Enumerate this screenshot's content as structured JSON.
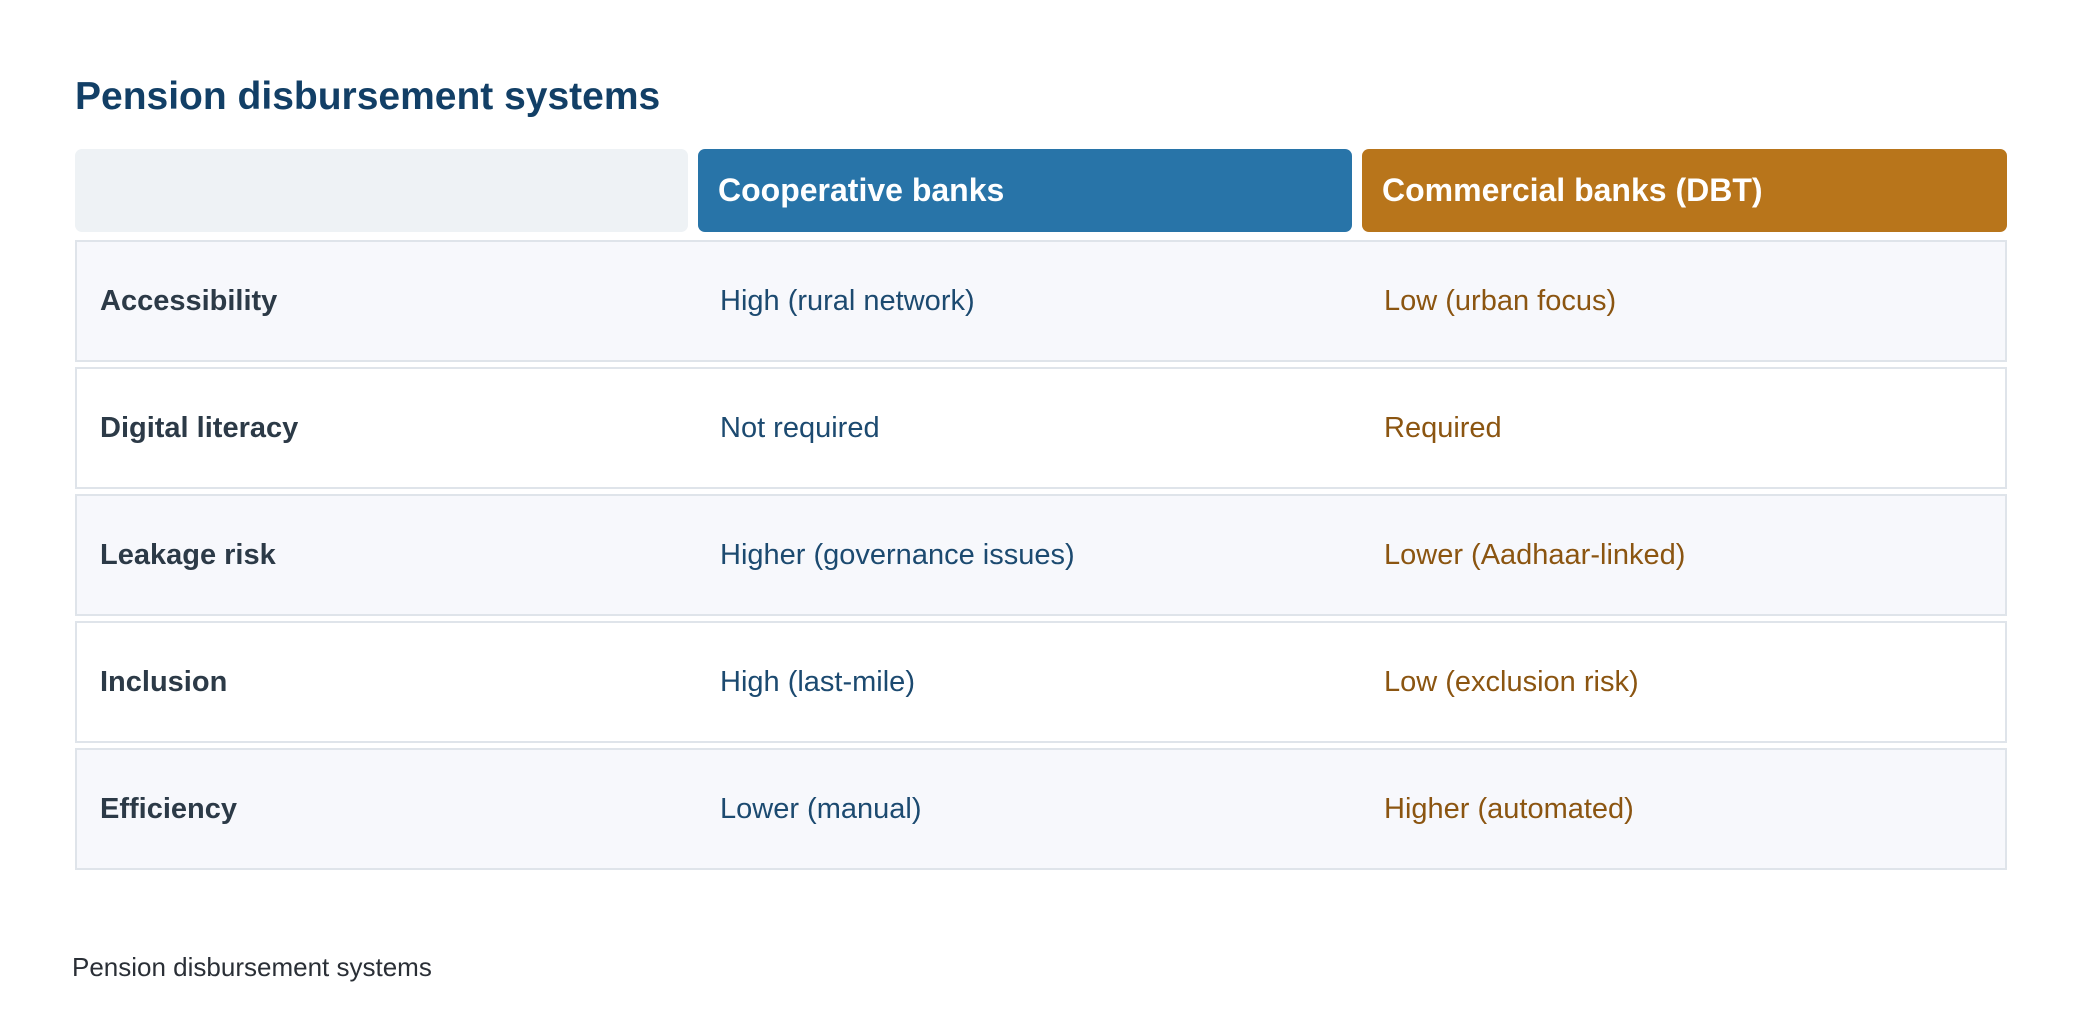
{
  "title": "Pension disbursement systems",
  "colors": {
    "cooperative": "#2874a8",
    "commercial": "#b8751b"
  },
  "columns": [
    "",
    "Cooperative banks",
    "Commercial banks (DBT)"
  ],
  "rows": [
    {
      "label": "Accessibility",
      "cooperative": "High (rural network)",
      "commercial": "Low (urban focus)"
    },
    {
      "label": "Digital literacy",
      "cooperative": "Not required",
      "commercial": "Required"
    },
    {
      "label": "Leakage risk",
      "cooperative": "Higher (governance issues)",
      "commercial": "Lower (Aadhaar-linked)"
    },
    {
      "label": "Inclusion",
      "cooperative": "High (last-mile)",
      "commercial": "Low (exclusion risk)"
    },
    {
      "label": "Efficiency",
      "cooperative": "Lower (manual)",
      "commercial": "Higher (automated)"
    }
  ],
  "caption": "Pension disbursement systems"
}
